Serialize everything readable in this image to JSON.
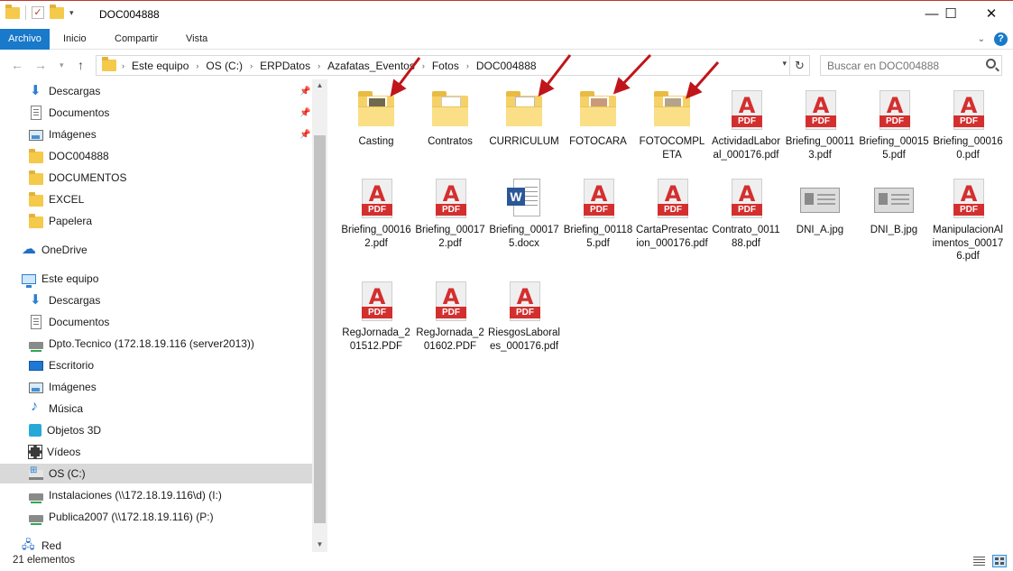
{
  "window": {
    "title": "DOC004888",
    "controls": {
      "minimize": "—",
      "maximize": "☐",
      "close": "✕"
    }
  },
  "ribbon": {
    "tabs": [
      "Archivo",
      "Inicio",
      "Compartir",
      "Vista"
    ],
    "help": "?"
  },
  "address": {
    "breadcrumbs": [
      "Este equipo",
      "OS (C:)",
      "ERPDatos",
      "Azafatas_Eventos",
      "Fotos",
      "DOC004888"
    ]
  },
  "search": {
    "placeholder": "Buscar en DOC004888"
  },
  "nav": {
    "items": [
      {
        "label": "Descargas",
        "icon": "download-icon",
        "pinned": true
      },
      {
        "label": "Documentos",
        "icon": "documents-icon",
        "pinned": true
      },
      {
        "label": "Imágenes",
        "icon": "pictures-icon",
        "pinned": true
      },
      {
        "label": "DOC004888",
        "icon": "folder-icon"
      },
      {
        "label": "DOCUMENTOS",
        "icon": "folder-icon"
      },
      {
        "label": "EXCEL",
        "icon": "folder-icon"
      },
      {
        "label": "Papelera",
        "icon": "folder-icon"
      },
      {
        "label": "OneDrive",
        "icon": "onedrive-icon"
      },
      {
        "label": "Este equipo",
        "icon": "this-pc-icon"
      },
      {
        "label": "Descargas",
        "icon": "download-icon"
      },
      {
        "label": "Documentos",
        "icon": "documents-icon"
      },
      {
        "label": "Dpto.Tecnico (172.18.19.116 (server2013))",
        "icon": "network-drive-icon"
      },
      {
        "label": "Escritorio",
        "icon": "desktop-icon"
      },
      {
        "label": "Imágenes",
        "icon": "pictures-icon"
      },
      {
        "label": "Música",
        "icon": "music-icon"
      },
      {
        "label": "Objetos 3D",
        "icon": "objects-3d-icon"
      },
      {
        "label": "Vídeos",
        "icon": "videos-icon"
      },
      {
        "label": "OS (C:)",
        "icon": "os-drive-icon",
        "selected": true
      },
      {
        "label": "Instalaciones (\\\\172.18.19.116\\d) (I:)",
        "icon": "network-drive-icon"
      },
      {
        "label": "Publica2007 (\\\\172.18.19.116) (P:)",
        "icon": "network-drive-icon"
      },
      {
        "label": "Red",
        "icon": "network-icon"
      }
    ]
  },
  "files": [
    {
      "label": "Casting",
      "type": "folder",
      "preview": "photo"
    },
    {
      "label": "Contratos",
      "type": "folder",
      "preview": "docs"
    },
    {
      "label": "CURRICULUM",
      "type": "folder",
      "preview": "pdf"
    },
    {
      "label": "FOTOCARA",
      "type": "folder",
      "preview": "face"
    },
    {
      "label": "FOTOCOMPLETA",
      "type": "folder",
      "preview": "full"
    },
    {
      "label": "ActividadLaboral_000176.pdf",
      "type": "pdf"
    },
    {
      "label": "Briefing_000113.pdf",
      "type": "pdf"
    },
    {
      "label": "Briefing_000155.pdf",
      "type": "pdf"
    },
    {
      "label": "Briefing_000160.pdf",
      "type": "pdf"
    },
    {
      "label": "Briefing_000162.pdf",
      "type": "pdf"
    },
    {
      "label": "Briefing_000172.pdf",
      "type": "pdf"
    },
    {
      "label": "Briefing_000175.docx",
      "type": "docx"
    },
    {
      "label": "Briefing_001185.pdf",
      "type": "pdf"
    },
    {
      "label": "CartaPresentacion_000176.pdf",
      "type": "pdf"
    },
    {
      "label": "Contrato_001188.pdf",
      "type": "pdf"
    },
    {
      "label": "DNI_A.jpg",
      "type": "jpg"
    },
    {
      "label": "DNI_B.jpg",
      "type": "jpg"
    },
    {
      "label": "ManipulacionAlimentos_000176.pdf",
      "type": "pdf"
    },
    {
      "label": "RegJornada_201512.PDF",
      "type": "pdf"
    },
    {
      "label": "RegJornada_201602.PDF",
      "type": "pdf"
    },
    {
      "label": "RiesgosLaborales_000176.pdf",
      "type": "pdf"
    }
  ],
  "icon_texts": {
    "pdf_letter": "A",
    "pdf_tag": "PDF",
    "word_letter": "W"
  },
  "status": {
    "count": "21 elementos"
  },
  "colors": {
    "accent": "#1979ca",
    "pdf_red": "#d32f2f",
    "folder": "#f6d168",
    "annotation_arrow": "#c0151a"
  }
}
